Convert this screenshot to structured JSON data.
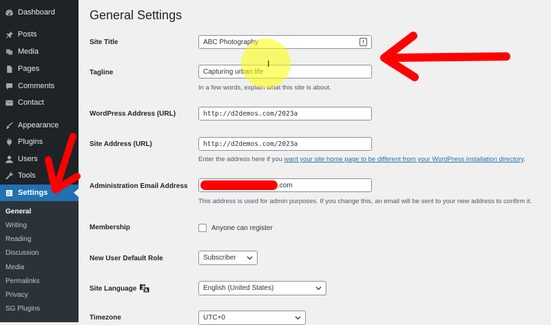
{
  "sidebar": {
    "items": [
      {
        "label": "Dashboard",
        "icon": "dashboard-icon"
      },
      {
        "label": "Posts",
        "icon": "pin-icon"
      },
      {
        "label": "Media",
        "icon": "media-icon"
      },
      {
        "label": "Pages",
        "icon": "pages-icon"
      },
      {
        "label": "Comments",
        "icon": "comments-icon"
      },
      {
        "label": "Contact",
        "icon": "mail-icon"
      },
      {
        "label": "Appearance",
        "icon": "brush-icon"
      },
      {
        "label": "Plugins",
        "icon": "plug-icon"
      },
      {
        "label": "Users",
        "icon": "user-icon"
      },
      {
        "label": "Tools",
        "icon": "wrench-icon"
      },
      {
        "label": "Settings",
        "icon": "settings-icon"
      }
    ],
    "submenu": [
      "General",
      "Writing",
      "Reading",
      "Discussion",
      "Media",
      "Permalinks",
      "Privacy",
      "SG Plugins"
    ]
  },
  "main": {
    "title": "General Settings",
    "site_title": {
      "label": "Site Title",
      "value": "ABC Photography"
    },
    "tagline": {
      "label": "Tagline",
      "value": "Capturing urban life",
      "desc": "In a few words, explain what this site is about."
    },
    "wp_address": {
      "label": "WordPress Address (URL)",
      "value": "http://d2demos.com/2023a"
    },
    "site_address": {
      "label": "Site Address (URL)",
      "value": "http://d2demos.com/2023a",
      "desc_prefix": "Enter the address here if you ",
      "desc_link": "want your site home page to be different from your WordPress installation directory",
      "desc_suffix": "."
    },
    "admin_email": {
      "label": "Administration Email Address",
      "value_suffix": ".com",
      "desc": "This address is used for admin purposes. If you change this, an email will be sent to your new address to confirm it."
    },
    "membership": {
      "label": "Membership",
      "checkbox_label": "Anyone can register"
    },
    "default_role": {
      "label": "New User Default Role",
      "value": "Subscriber"
    },
    "language": {
      "label": "Site Language",
      "value": "English (United States)"
    },
    "timezone": {
      "label": "Timezone",
      "value": "UTC+0"
    }
  },
  "colors": {
    "sidebar": "#1d2327",
    "accent": "#2271b1",
    "annotation": "#ff0000",
    "highlight": "#ffff00"
  }
}
